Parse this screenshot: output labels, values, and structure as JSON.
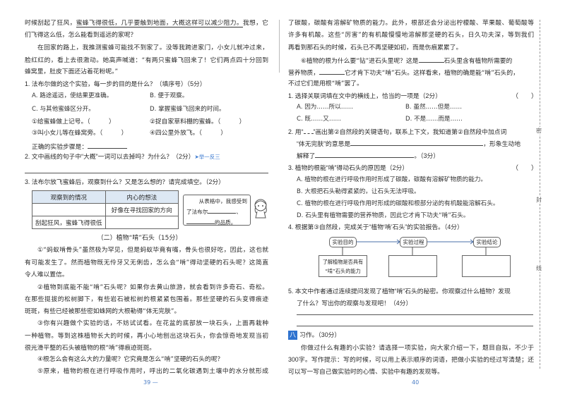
{
  "left": {
    "l1": {
      "pre": "时候刮起了狂风，",
      "underlined": "蜜蜂飞得很低，几乎要触到地面，大概这样可以减少阻力。",
      "post": "我想，它"
    },
    "l2": "们飞得这么低，怎么能看到遥远的家呢？",
    "l3": "在回家的路上，我推测蜜蜂可能找不到家了。没等我跨进家门，小女儿就冲过来，",
    "l4": "脸红红的，看上去很激动。她高声喊道：“有两只蜜蜂飞回来了！它们两点四十分回到",
    "l5": "蜂窝里，肚皮下面还沾着花粉呢。”",
    "q1": {
      "text": "1. 法布尔做的这个实验，每一步的目的是什么？（填序号）（5分）",
      "options": [
        "A. 路途遥远，使结果更准确。",
        "B. 便于观察。",
        "C. 与其他蜜蜂区分开。",
        "D. 掌握蜜蜂飞回来的时间。"
      ],
      "steps": [
        "①给蜜蜂做上记号。（　　　）",
        "②捉自家草料棚的蜜蜂。（　　　）",
        "③叫小女儿等在蜂窝旁。（　　　）",
        "④四公里外放飞。（　　　）"
      ],
      "order_label": "正确的实验步骤是："
    },
    "q2": {
      "text": "2. 文中画线的句子中“大概”一词可以去掉吗？为什么？（2分）",
      "tag": "➤举一反三"
    },
    "q3": {
      "text": "3. 法布尔放飞蜜蜂后，观察到什么？又是怎么想的？请完成填空。（2分）",
      "headers": [
        "观察到的情况",
        "内心的想法"
      ],
      "rows": [
        [
          "",
          "好像在寻找回家的方向"
        ],
        [
          "刮起狂风，蜜蜂飞得很低",
          ""
        ]
      ],
      "bubble": {
        "a": "从表格中，我感受到",
        "b": "了法布尔",
        "c": "、",
        "d": "的品质。"
      }
    },
    "section_title": "（二）植物“啃”石头（15分）",
    "p": [
      "①“蚂蚁啃骨头”虽然极为罕见，但是蚂蚁毕竟有嘴，骨头也很好吃，因此，这也就",
      "有可能发生了。然而植物既无伶牙又无俐齿，怎么会“啃”得动坚硬的石头呢？这简直",
      "令人难以置信。",
      "②植物到底能不能“啃”石头呢？如果你去黄山旅游，就会看到许多奇石、奇松。",
      "在那些挺拔的松树脚下，有些岩石被松树的根紧紧包围着。那些坚硬的石头变得痕迹",
      "斑斑，有些已经被那些密如蛛网的大根勒得“体无完肤”。",
      "③你有兴趣做个实验的话，不妨试试看。在花盆的底部放一块石头，上面再栽种",
      "一种植物。等到这株植物长大的时候，再小心地刨出这块石头，你会惊奇地发现当初",
      "很光滑平整的石头被植物的根“啃”得痕迹斑斑。",
      "④根怎么会有这么大的力量呢？它究竟是怎么“啃”坚硬的石头的呢？",
      "⑤原来，植物的根在进行呼吸作用时，呼出的二氧化碳遇到土壤中的水分就形成"
    ],
    "page_number": "39 —"
  },
  "right": {
    "p": [
      "了碳酸，碳酸有溶解矿物质的能力。此外，根部还会分泌出柠檬酸、苹果酸、葡萄酸等",
      "许多有机酸。这些“厉害”的有机酸慢慢地溶解那坚硬的石头，日久功夫深，等到我们",
      "再看到那石头的时候，石头已不再坚硬如初，而是伤痕累累了。"
    ],
    "p6": {
      "a": "⑥植物的根为什么要“钻”进石头里呢？这是",
      "b": "石头里含有植物所需要的",
      "c": "营养物质，",
      "d": "它才肯下功夫“啃”石头。这样看来，植物的确是能“啃”石头的，",
      "e": "不过它们是用根“啃”罢了。"
    },
    "q1": {
      "text": "1. 选择关联词填在文中的横线上，恰当的一项是（2分）",
      "paren": "（　　）",
      "options": [
        "A. 因为……所以……",
        "B. 虽然……但是……",
        "C. 既……又……",
        "D. 不是……而是……"
      ]
    },
    "q2": {
      "a": "2. 用“",
      "b": "”画出第②自然段的关键语句，联系上下文，我知道第②自然段中加点词",
      "c": "“体无完肤”的意思是",
      "d": "，形象生动地",
      "e": "解释了",
      "f": "。（3分）"
    },
    "q3": {
      "text": "3. 植物的根能“啃”得动石头的原因是（2分）",
      "paren": "（　　）",
      "options": [
        "A. 植物的根在进行呼吸作用时形成了碳酸，碳酸有溶解矿物质的能力。",
        "B. 大根把石头勒得紧紧的，让石头无法呼吸。",
        "C. 植物的根在进行呼吸作用时形成的碳酸和根部分泌的有机酸能溶解石头。",
        "D. 石头里有植物需要的营养物质，因此它才肯下功夫“啃”石头。"
      ]
    },
    "q4": {
      "text": "4. 根据第③自然段，完成关于“植物‘啃’石头”的实验报告。（4分）",
      "labels": [
        "实验目的",
        "实验过程",
        "实验结论"
      ],
      "purpose_a": "了解植物是否具有",
      "purpose_b": "“啃”石头的能力"
    },
    "q5": {
      "a": "5. 本文中作者通过连续提问发现了植物“啃”石头的秘密。你观察过什么植物？发现",
      "b": "了什么？写出你的观察与发现吧！（4分）"
    },
    "writing": {
      "badge": "八",
      "title": "习作。（30分）",
      "lines": [
        "你做过什么有趣的小实验？请选择一项实验，向大家介绍一下，题目自拟，不少于",
        "300字。写作提示：写的时候，可以用上表示顺序的词语，把做小实验的经过写清楚；还",
        "可以写一写自己做实验时的心情、实验中有趣的发现等。"
      ]
    },
    "margin_chars": [
      "密",
      "封",
      "线"
    ],
    "page_number": "40"
  }
}
